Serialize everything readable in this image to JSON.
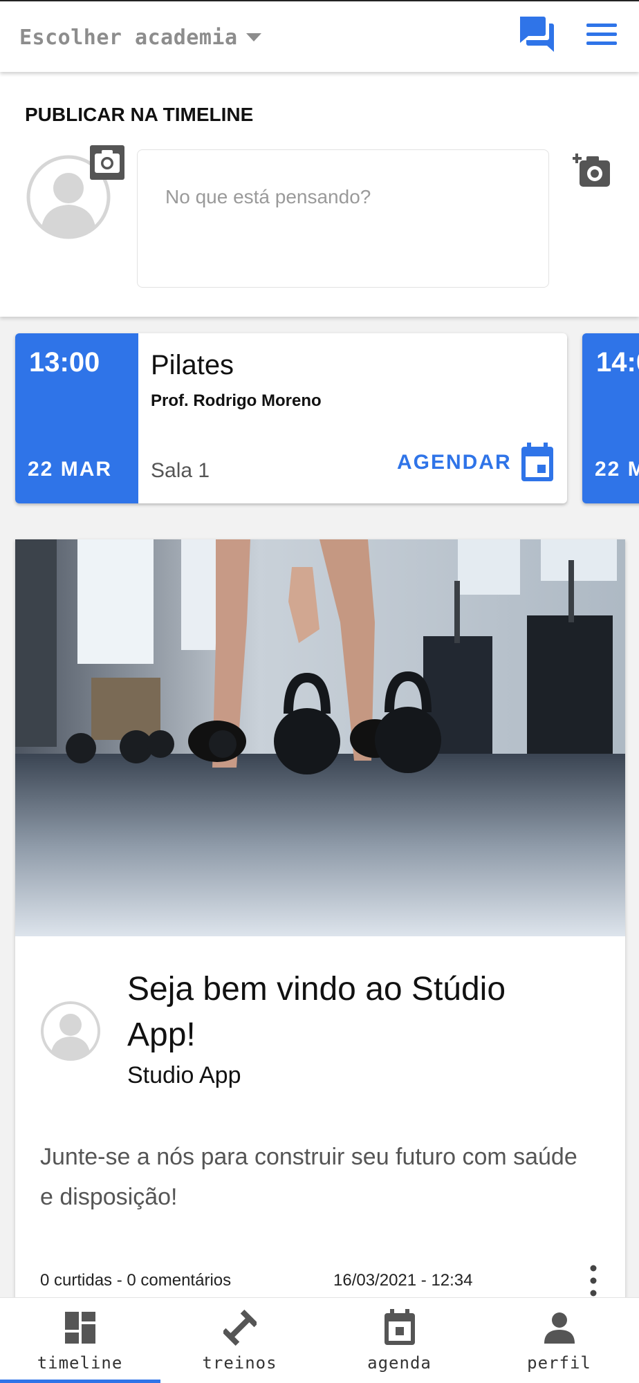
{
  "header": {
    "gym_select_label": "Escolher academia",
    "accent_color": "#2f74e8"
  },
  "publish": {
    "title": "PUBLICAR NA TIMELINE",
    "input_placeholder": "No que está pensando?"
  },
  "classes": [
    {
      "time": "13:00",
      "date": "22 MAR",
      "name": "Pilates",
      "professor": "Prof. Rodrigo Moreno",
      "room": "Sala 1",
      "action_label": "AGENDAR"
    },
    {
      "time": "14:0",
      "date": "22 M"
    }
  ],
  "post": {
    "image_name": "kettlebell-gym-photo",
    "title": "Seja bem vindo ao Stúdio App!",
    "author": "Studio App",
    "text": "Junte-se a nós para construir seu futuro com saúde e disposição!",
    "stats": "0 curtidas  - 0 comentários",
    "date": "16/03/2021 - 12:34"
  },
  "bottom_nav": {
    "items": [
      {
        "label": "timeline",
        "icon": "dashboard-icon",
        "active": true
      },
      {
        "label": "treinos",
        "icon": "dumbbell-icon",
        "active": false
      },
      {
        "label": "agenda",
        "icon": "calendar-icon",
        "active": false
      },
      {
        "label": "perfil",
        "icon": "person-icon",
        "active": false
      }
    ]
  }
}
